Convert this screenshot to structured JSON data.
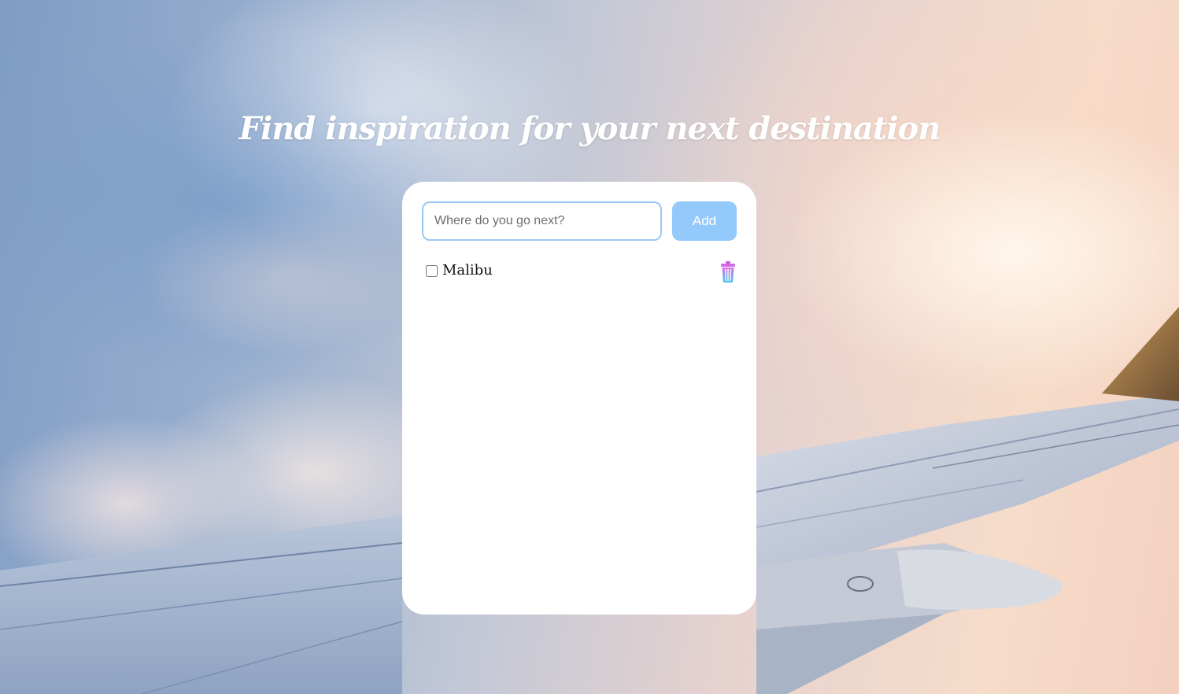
{
  "page": {
    "headline": "Find inspiration for your next destination"
  },
  "form": {
    "input_value": "",
    "input_placeholder": "Where do you go next?",
    "add_label": "Add"
  },
  "items": [
    {
      "label": "Malibu",
      "checked": false,
      "delete_icon": "trash-icon"
    }
  ],
  "colors": {
    "add_button": "#94c9fb",
    "input_border": "#9bc8f2",
    "trash_top": "#e06ce8",
    "trash_bottom": "#3ec7f0"
  }
}
